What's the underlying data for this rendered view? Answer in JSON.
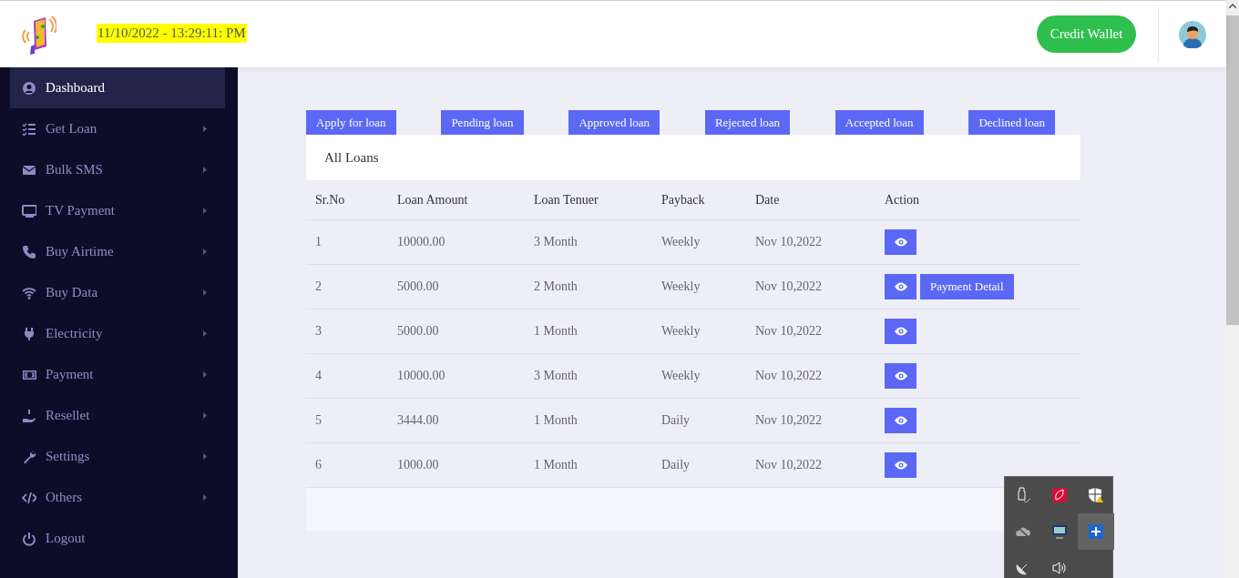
{
  "header": {
    "datetime": "11/10/2022 - 13:29:11: PM",
    "wallet_button": "Credit Wallet"
  },
  "sidebar": {
    "items": [
      {
        "label": "Dashboard",
        "selected": true,
        "has_submenu": false
      },
      {
        "label": "Get Loan",
        "selected": false,
        "has_submenu": true
      },
      {
        "label": "Bulk SMS",
        "selected": false,
        "has_submenu": true
      },
      {
        "label": "TV Payment",
        "selected": false,
        "has_submenu": true
      },
      {
        "label": "Buy Airtime",
        "selected": false,
        "has_submenu": true
      },
      {
        "label": "Buy Data",
        "selected": false,
        "has_submenu": true
      },
      {
        "label": "Electricity",
        "selected": false,
        "has_submenu": true
      },
      {
        "label": "Payment",
        "selected": false,
        "has_submenu": true
      },
      {
        "label": "Resellet",
        "selected": false,
        "has_submenu": true
      },
      {
        "label": "Settings",
        "selected": false,
        "has_submenu": true
      },
      {
        "label": "Others",
        "selected": false,
        "has_submenu": true
      },
      {
        "label": "Logout",
        "selected": false,
        "has_submenu": false
      }
    ]
  },
  "filters": [
    "Apply for loan",
    "Pending loan",
    "Approved loan",
    "Rejected loan",
    "Accepted loan",
    "Declined loan"
  ],
  "table": {
    "title": "All Loans",
    "columns": [
      "Sr.No",
      "Loan Amount",
      "Loan Tenuer",
      "Payback",
      "Date",
      "Action"
    ],
    "rows": [
      {
        "cells": [
          "1",
          "10000.00",
          "3 Month",
          "Weekly",
          "Nov 10,2022"
        ],
        "actions": [
          {
            "kind": "view"
          }
        ]
      },
      {
        "cells": [
          "2",
          "5000.00",
          "2 Month",
          "Weekly",
          "Nov 10,2022"
        ],
        "actions": [
          {
            "kind": "view"
          },
          {
            "kind": "text",
            "label": "Payment Detail"
          }
        ]
      },
      {
        "cells": [
          "3",
          "5000.00",
          "1 Month",
          "Weekly",
          "Nov 10,2022"
        ],
        "actions": [
          {
            "kind": "view"
          }
        ]
      },
      {
        "cells": [
          "4",
          "10000.00",
          "3 Month",
          "Weekly",
          "Nov 10,2022"
        ],
        "actions": [
          {
            "kind": "view"
          }
        ]
      },
      {
        "cells": [
          "5",
          "3444.00",
          "1 Month",
          "Daily",
          "Nov 10,2022"
        ],
        "actions": [
          {
            "kind": "view"
          }
        ]
      },
      {
        "cells": [
          "6",
          "1000.00",
          "1 Month",
          "Daily",
          "Nov 10,2022"
        ],
        "actions": [
          {
            "kind": "view"
          }
        ]
      }
    ]
  }
}
